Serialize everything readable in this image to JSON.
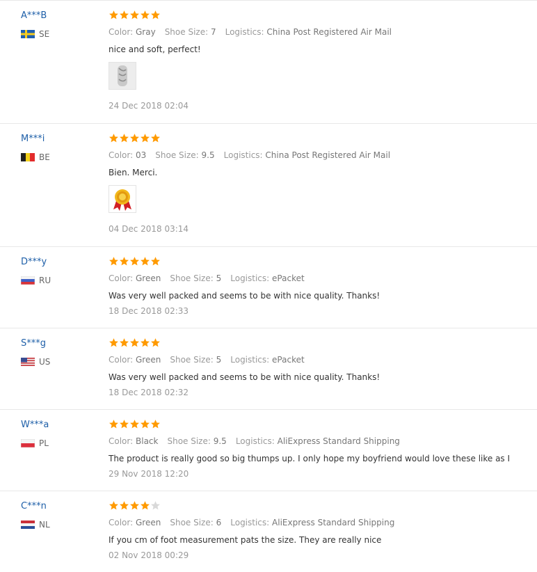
{
  "labels": {
    "color": "Color:",
    "shoe_size": "Shoe Size:",
    "logistics": "Logistics:"
  },
  "star_colors": {
    "filled": "#ff9a00",
    "empty": "#d9d9d9"
  },
  "reviews": [
    {
      "user": "A***B",
      "country": "SE",
      "flag": "flag-sweden",
      "rating": 5,
      "color": "Gray",
      "shoe_size": "7",
      "logistics": "China Post Registered Air Mail",
      "text": "nice and soft, perfect!",
      "has_photo": true,
      "photo_icon": "shoe-photo-thumbnail",
      "date": "24 Dec 2018 02:04"
    },
    {
      "user": "M***i",
      "country": "BE",
      "flag": "flag-belgium",
      "rating": 5,
      "color": "03",
      "shoe_size": "9.5",
      "logistics": "China Post Registered Air Mail",
      "text": "Bien. Merci.",
      "has_photo": true,
      "photo_icon": "award-medal-thumbnail",
      "date": "04 Dec 2018 03:14"
    },
    {
      "user": "D***y",
      "country": "RU",
      "flag": "flag-russia",
      "rating": 5,
      "color": "Green",
      "shoe_size": "5",
      "logistics": "ePacket",
      "text": "Was very well packed and seems to be with nice quality. Thanks!",
      "has_photo": false,
      "date": "18 Dec 2018 02:33"
    },
    {
      "user": "S***g",
      "country": "US",
      "flag": "flag-usa",
      "rating": 5,
      "color": "Green",
      "shoe_size": "5",
      "logistics": "ePacket",
      "text": "Was very well packed and seems to be with nice quality. Thanks!",
      "has_photo": false,
      "date": "18 Dec 2018 02:32"
    },
    {
      "user": "W***a",
      "country": "PL",
      "flag": "flag-poland",
      "rating": 5,
      "color": "Black",
      "shoe_size": "9.5",
      "logistics": "AliExpress Standard Shipping",
      "text": "The product is really good so big thumps up. I only hope my boyfriend would love these like as I",
      "has_photo": false,
      "date": "29 Nov 2018 12:20"
    },
    {
      "user": "C***n",
      "country": "NL",
      "flag": "flag-netherlands",
      "rating": 4,
      "color": "Green",
      "shoe_size": "6",
      "logistics": "AliExpress Standard Shipping",
      "text": "If you cm of foot measurement pats the size. They are really nice",
      "has_photo": false,
      "date": "02 Nov 2018 00:29"
    }
  ]
}
